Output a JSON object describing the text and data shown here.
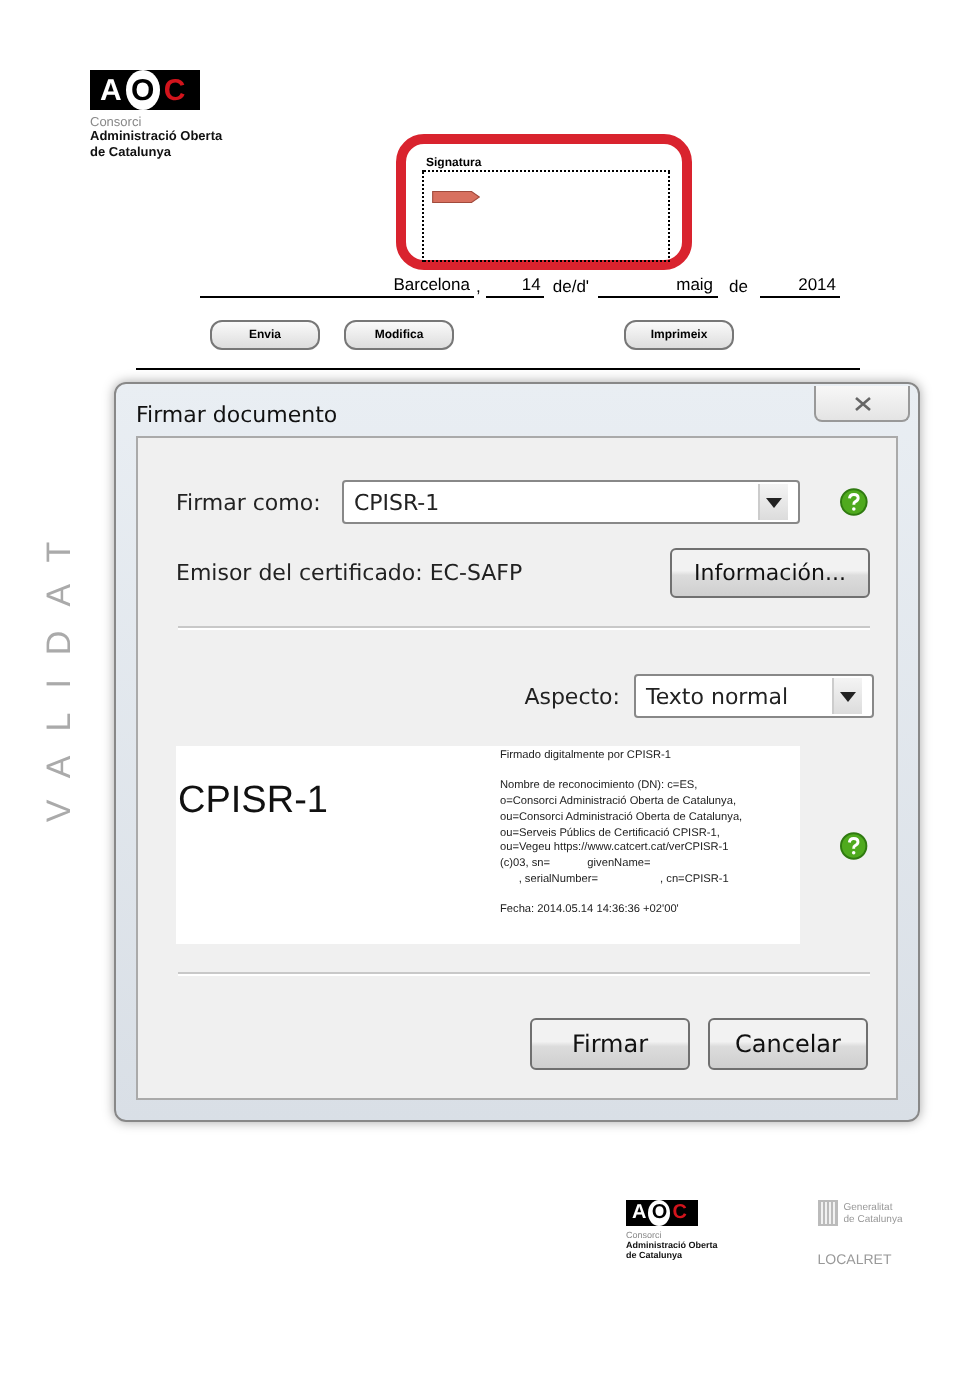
{
  "header_logo": {
    "letters": [
      "A",
      "O",
      "C"
    ],
    "caption": [
      "Consorci",
      "Administració Oberta",
      "de Catalunya"
    ]
  },
  "watermark_side": "VALIDAT",
  "signature_field": {
    "label": "Signatura",
    "highlighted": true
  },
  "date_line": {
    "place": "Barcelona",
    "separator": ",",
    "day": "14",
    "day_suffix": "de/d'",
    "month": "maig",
    "year_prefix": "de",
    "year": "2014"
  },
  "form_buttons": [
    {
      "label": "Envia"
    },
    {
      "label": "Modifica"
    },
    {
      "label": "Imprimeix"
    }
  ],
  "dialog": {
    "title": "Firmar documento",
    "sign_as": {
      "label": "Firmar como:",
      "value": "CPISR-1"
    },
    "issuer": "Emisor del certificado: EC-SAFP",
    "info_button": "Información...",
    "appearance": {
      "label": "Aspecto:",
      "value": "Texto normal"
    },
    "preview": {
      "name": "CPISR-1",
      "paragraphs": [
        [
          "Firmado digitalmente por CPISR-1"
        ],
        [
          "Nombre de reconocimiento (DN): c=ES,",
          "o=Consorci Administració Oberta de Catalunya,",
          "ou=Consorci Administració Oberta de Catalunya,",
          "ou=Serveis Públics de Certificació CPISR-1,",
          "ou=Vegeu https://www.catcert.cat/verCPISR-1",
          "(c)03, sn=            givenName=",
          "      , serialNumber=                    , cn=CPISR-1"
        ],
        [
          "Fecha: 2014.05.14 14:36:36 +02'00'"
        ]
      ]
    },
    "buttons": [
      {
        "label": "Firmar"
      },
      {
        "label": "Cancelar"
      }
    ]
  },
  "footer": {
    "aoc_logo": {
      "letters": [
        "A",
        "O",
        "C"
      ],
      "caption": [
        "Consorci",
        "Administració Oberta",
        "de Catalunya"
      ]
    },
    "generalitat": [
      "Generalitat",
      "de Catalunya"
    ],
    "localret": "LOCALRET"
  }
}
